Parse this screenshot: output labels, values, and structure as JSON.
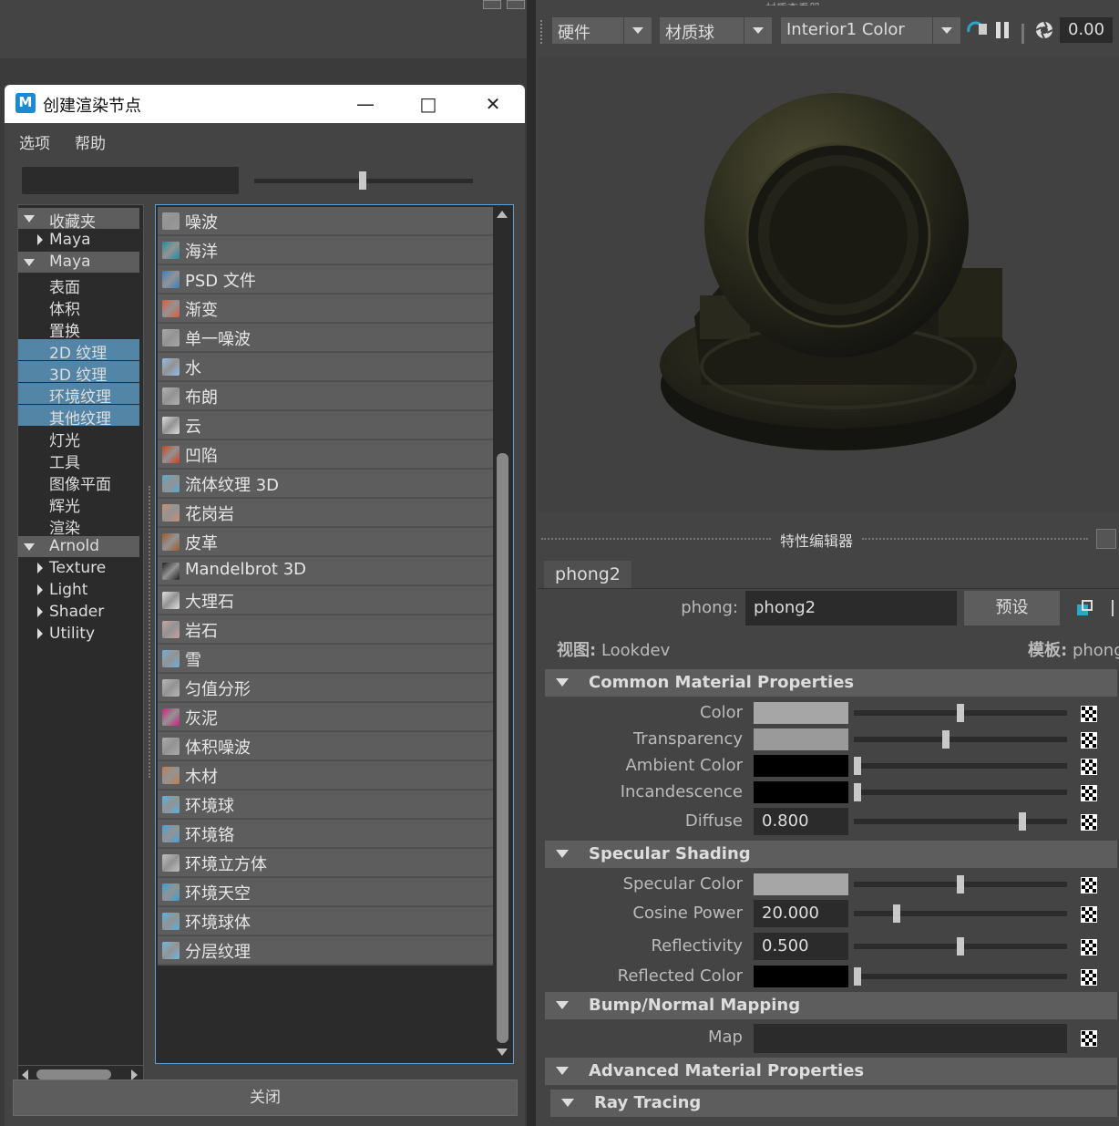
{
  "left_panel": {
    "dialog": {
      "title": "创建渲染节点",
      "logo_letter": "M",
      "menus": [
        "选项",
        "帮助"
      ],
      "close_label": "关闭",
      "tree": [
        {
          "label": "收藏夹",
          "kind": "header",
          "expanded": true
        },
        {
          "label": "Maya",
          "kind": "child-collapsed"
        },
        {
          "label": "Maya",
          "kind": "header",
          "expanded": true
        },
        {
          "label": "表面",
          "kind": "leaf"
        },
        {
          "label": "体积",
          "kind": "leaf"
        },
        {
          "label": "置换",
          "kind": "leaf"
        },
        {
          "label": "2D 纹理",
          "kind": "leaf",
          "selected": true
        },
        {
          "label": "3D 纹理",
          "kind": "leaf",
          "selected": true
        },
        {
          "label": "环境纹理",
          "kind": "leaf",
          "selected": true
        },
        {
          "label": "其他纹理",
          "kind": "leaf",
          "selected": true
        },
        {
          "label": "灯光",
          "kind": "leaf"
        },
        {
          "label": "工具",
          "kind": "leaf"
        },
        {
          "label": "图像平面",
          "kind": "leaf"
        },
        {
          "label": "辉光",
          "kind": "leaf"
        },
        {
          "label": "渲染",
          "kind": "leaf"
        },
        {
          "label": "Arnold",
          "kind": "header",
          "expanded": true
        },
        {
          "label": "Texture",
          "kind": "child-collapsed"
        },
        {
          "label": "Light",
          "kind": "child-collapsed"
        },
        {
          "label": "Shader",
          "kind": "child-collapsed"
        },
        {
          "label": "Utility",
          "kind": "child-collapsed"
        }
      ],
      "nodes": [
        {
          "label": "噪波",
          "icon": "noise-icon",
          "color": "#9a9a9a"
        },
        {
          "label": "海洋",
          "icon": "ocean-icon",
          "color": "#1f8fa0"
        },
        {
          "label": "PSD 文件",
          "icon": "psd-file-icon",
          "color": "#3a7fc0"
        },
        {
          "label": "渐变",
          "icon": "ramp-icon",
          "color": "#e05a3a"
        },
        {
          "label": "单一噪波",
          "icon": "single-noise-icon",
          "color": "#a8a8a8"
        },
        {
          "label": "水",
          "icon": "water-icon",
          "color": "#8fbfe8"
        },
        {
          "label": "布朗",
          "icon": "brownian-icon",
          "color": "#b0b0b0"
        },
        {
          "label": "云",
          "icon": "cloud-icon",
          "color": "#dddddd"
        },
        {
          "label": "凹陷",
          "icon": "crater-icon",
          "color": "#d04020"
        },
        {
          "label": "流体纹理 3D",
          "icon": "fluid-texture-icon",
          "color": "#5aa8d0"
        },
        {
          "label": "花岗岩",
          "icon": "granite-icon",
          "color": "#c89070"
        },
        {
          "label": "皮革",
          "icon": "leather-icon",
          "color": "#a05a2a"
        },
        {
          "label": "Mandelbrot 3D",
          "icon": "mandelbrot-icon",
          "color": "#222222"
        },
        {
          "label": "大理石",
          "icon": "marble-icon",
          "color": "#e0e0e0"
        },
        {
          "label": "岩石",
          "icon": "rock-icon",
          "color": "#c8a0a0"
        },
        {
          "label": "雪",
          "icon": "snow-icon",
          "color": "#6fb0d8"
        },
        {
          "label": "匀值分形",
          "icon": "solid-fractal-icon",
          "color": "#b8b8b8"
        },
        {
          "label": "灰泥",
          "icon": "stucco-icon",
          "color": "#d02080"
        },
        {
          "label": "体积噪波",
          "icon": "volume-noise-icon",
          "color": "#aaaaaa"
        },
        {
          "label": "木材",
          "icon": "wood-icon",
          "color": "#c08050"
        },
        {
          "label": "环境球",
          "icon": "env-ball-icon",
          "color": "#5ab0e0"
        },
        {
          "label": "环境铬",
          "icon": "env-chrome-icon",
          "color": "#4aa0d8"
        },
        {
          "label": "环境立方体",
          "icon": "env-cube-icon",
          "color": "#c0c0c0"
        },
        {
          "label": "环境天空",
          "icon": "env-sky-icon",
          "color": "#3aa0d0"
        },
        {
          "label": "环境球体",
          "icon": "env-sphere-icon",
          "color": "#5ab0e0"
        },
        {
          "label": "分层纹理",
          "icon": "layered-texture-icon",
          "color": "#70b8e0"
        }
      ]
    }
  },
  "material_viewer": {
    "title_partial": "材质查看器",
    "renderer": "硬件",
    "shape": "材质球",
    "env": "Interior1 Color",
    "time": "0.00"
  },
  "attribute_editor": {
    "title": "特性编辑器",
    "tab": "phong2",
    "node_type_label": "phong:",
    "node_name": "phong2",
    "preset_label": "预设",
    "view_label": "视图:",
    "view_value": "Lookdev",
    "template_label": "模板:",
    "template_value": "phong",
    "sections": {
      "common": "Common Material Properties",
      "specular": "Specular Shading",
      "bump": "Bump/Normal Mapping",
      "advanced": "Advanced Material Properties",
      "ray": "Ray Tracing"
    },
    "attrs": {
      "color": {
        "label": "Color",
        "swatch": "#a6a6a6",
        "slider": 0.5
      },
      "transparency": {
        "label": "Transparency",
        "swatch": "#9a9a9a",
        "slider": 0.43
      },
      "ambient": {
        "label": "Ambient Color",
        "swatch": "#000000",
        "slider": 0.0
      },
      "incandescence": {
        "label": "Incandescence",
        "swatch": "#000000",
        "slider": 0.0
      },
      "diffuse": {
        "label": "Diffuse",
        "value": "0.800",
        "slider": 0.8
      },
      "specular_color": {
        "label": "Specular Color",
        "swatch": "#a6a6a6",
        "slider": 0.5
      },
      "cosine_power": {
        "label": "Cosine Power",
        "value": "20.000",
        "slider": 0.19
      },
      "reflectivity": {
        "label": "Reflectivity",
        "value": "0.500",
        "slider": 0.5
      },
      "reflected_color": {
        "label": "Reflected Color",
        "swatch": "#000000",
        "slider": 0.0
      },
      "map": {
        "label": "Map"
      }
    }
  }
}
